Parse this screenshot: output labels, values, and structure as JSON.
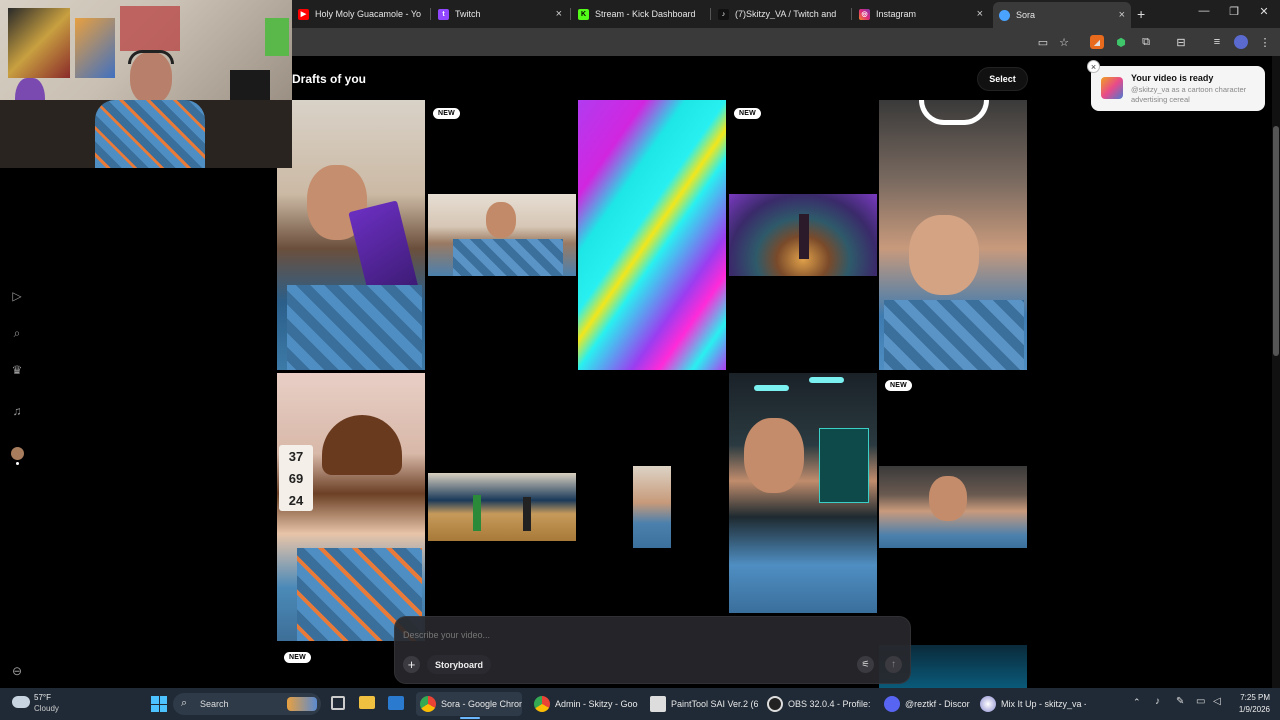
{
  "browser": {
    "tabs": [
      {
        "title": "Holy Moly Guacamole - Yo",
        "icon": "youtube-icon",
        "color": "#ff0000",
        "active": false
      },
      {
        "title": "Twitch",
        "icon": "twitch-icon",
        "color": "#9146ff",
        "active": false
      },
      {
        "title": "Stream - Kick Dashboard",
        "icon": "kick-icon",
        "color": "#53fc18",
        "active": false
      },
      {
        "title": "(7)Skitzy_VA / Twitch and",
        "icon": "tiktok-icon",
        "color": "#111111",
        "active": false
      },
      {
        "title": "Instagram",
        "icon": "instagram-icon",
        "color": "#e1306c",
        "active": false
      },
      {
        "title": "Sora",
        "icon": "sora-icon",
        "color": "#4aa3ff",
        "active": true
      }
    ],
    "new_tab_label": "+",
    "close_glyph": "×"
  },
  "page": {
    "title": "Drafts of you",
    "select_label": "Select",
    "new_badge": "NEW",
    "tiles": [
      {
        "name": "tile-1",
        "badge": false,
        "desc": "guy with cereal box"
      },
      {
        "name": "tile-2",
        "badge": true
      },
      {
        "name": "tile-3",
        "badge": false
      },
      {
        "name": "tile-4",
        "badge": true
      },
      {
        "name": "tile-5",
        "badge": true
      },
      {
        "name": "tile-6",
        "badge": false
      },
      {
        "name": "tile-7",
        "badge": false
      },
      {
        "name": "tile-8",
        "badge": false
      },
      {
        "name": "tile-9",
        "badge": false
      },
      {
        "name": "tile-10",
        "badge": true
      },
      {
        "name": "tile-11",
        "badge": true
      }
    ],
    "anime_numbers": [
      "37",
      "69",
      "24"
    ]
  },
  "toast": {
    "title": "Your video is ready",
    "subtitle": "@skitzy_va as a cartoon character advertising cereal"
  },
  "composer": {
    "placeholder": "Describe your video...",
    "storyboard_label": "Storyboard",
    "add_glyph": "+"
  },
  "taskbar": {
    "weather_temp": "57°F",
    "weather_desc": "Cloudy",
    "search_label": "Search",
    "items": [
      {
        "label": "Sora - Google Chrome",
        "active": true
      },
      {
        "label": "Admin - Skitzy - Googl",
        "active": false
      },
      {
        "label": "PaintTool SAI Ver.2 (64l",
        "active": false
      },
      {
        "label": "OBS 32.0.4 - Profile: Str",
        "active": false
      },
      {
        "label": "@reztkf - Discord",
        "active": false
      },
      {
        "label": "Mix It Up - skitzy_va - v",
        "active": false
      }
    ],
    "time": "7:25 PM",
    "date": "1/9/2026"
  }
}
